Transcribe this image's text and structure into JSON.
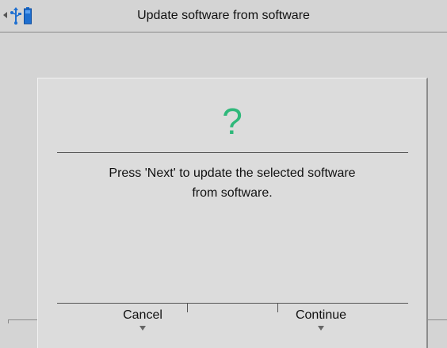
{
  "header": {
    "title": "Update software from software",
    "icons": [
      "left-arrow-icon",
      "usb-icon",
      "battery-icon"
    ]
  },
  "dialog": {
    "icon": "question-mark",
    "icon_glyph": "?",
    "icon_color": "#2fb87a",
    "message_line1": "Press 'Next' to update the selected software",
    "message_line2": "from software."
  },
  "softkeys": {
    "cancel": "Cancel",
    "continue": "Continue"
  },
  "colors": {
    "background": "#d4d4d4",
    "dialog": "#dcdcdc",
    "usb": "#1e6fd0",
    "battery": "#1e6fd0"
  }
}
